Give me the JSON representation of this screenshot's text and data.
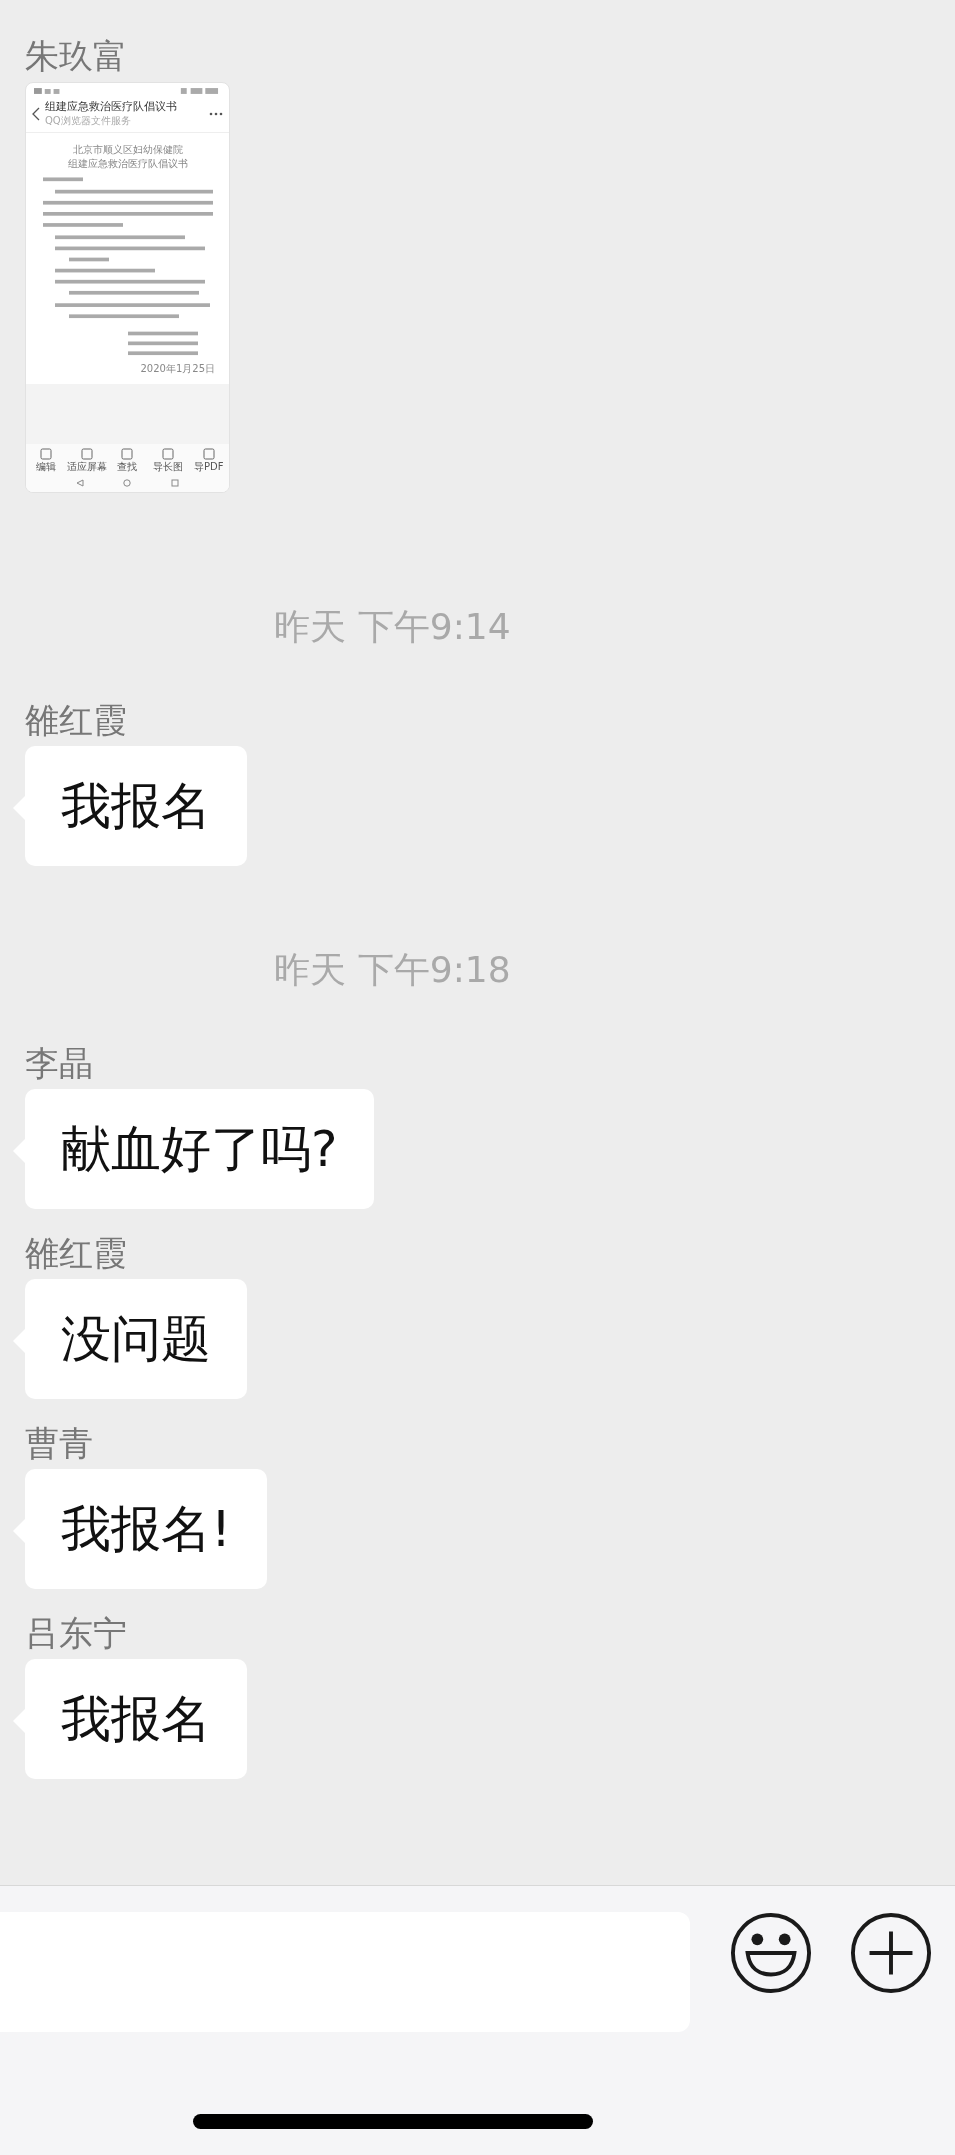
{
  "messages": [
    {
      "kind": "image",
      "sender": "朱玖富",
      "document": {
        "title": "组建应急救治医疗队倡议书",
        "subtitle": "QQ浏览器文件服务",
        "heading": [
          "北京市顺义区妇幼保健院",
          "组建应急救治医疗队倡议书"
        ],
        "date": "2020年1月25日",
        "tools": [
          "编辑",
          "适应屏幕",
          "查找",
          "导长图",
          "导PDF"
        ]
      }
    },
    {
      "kind": "time",
      "time": "昨天 下午9:14"
    },
    {
      "kind": "text",
      "sender": "雒红霞",
      "text": "我报名"
    },
    {
      "kind": "time",
      "time": "昨天 下午9:18"
    },
    {
      "kind": "text",
      "sender": "李晶",
      "text": "献血好了吗?"
    },
    {
      "kind": "text",
      "sender": "雒红霞",
      "text": "没问题"
    },
    {
      "kind": "text",
      "sender": "曹青",
      "text": "我报名!"
    },
    {
      "kind": "text",
      "sender": "吕东宁",
      "text": "我报名"
    }
  ]
}
